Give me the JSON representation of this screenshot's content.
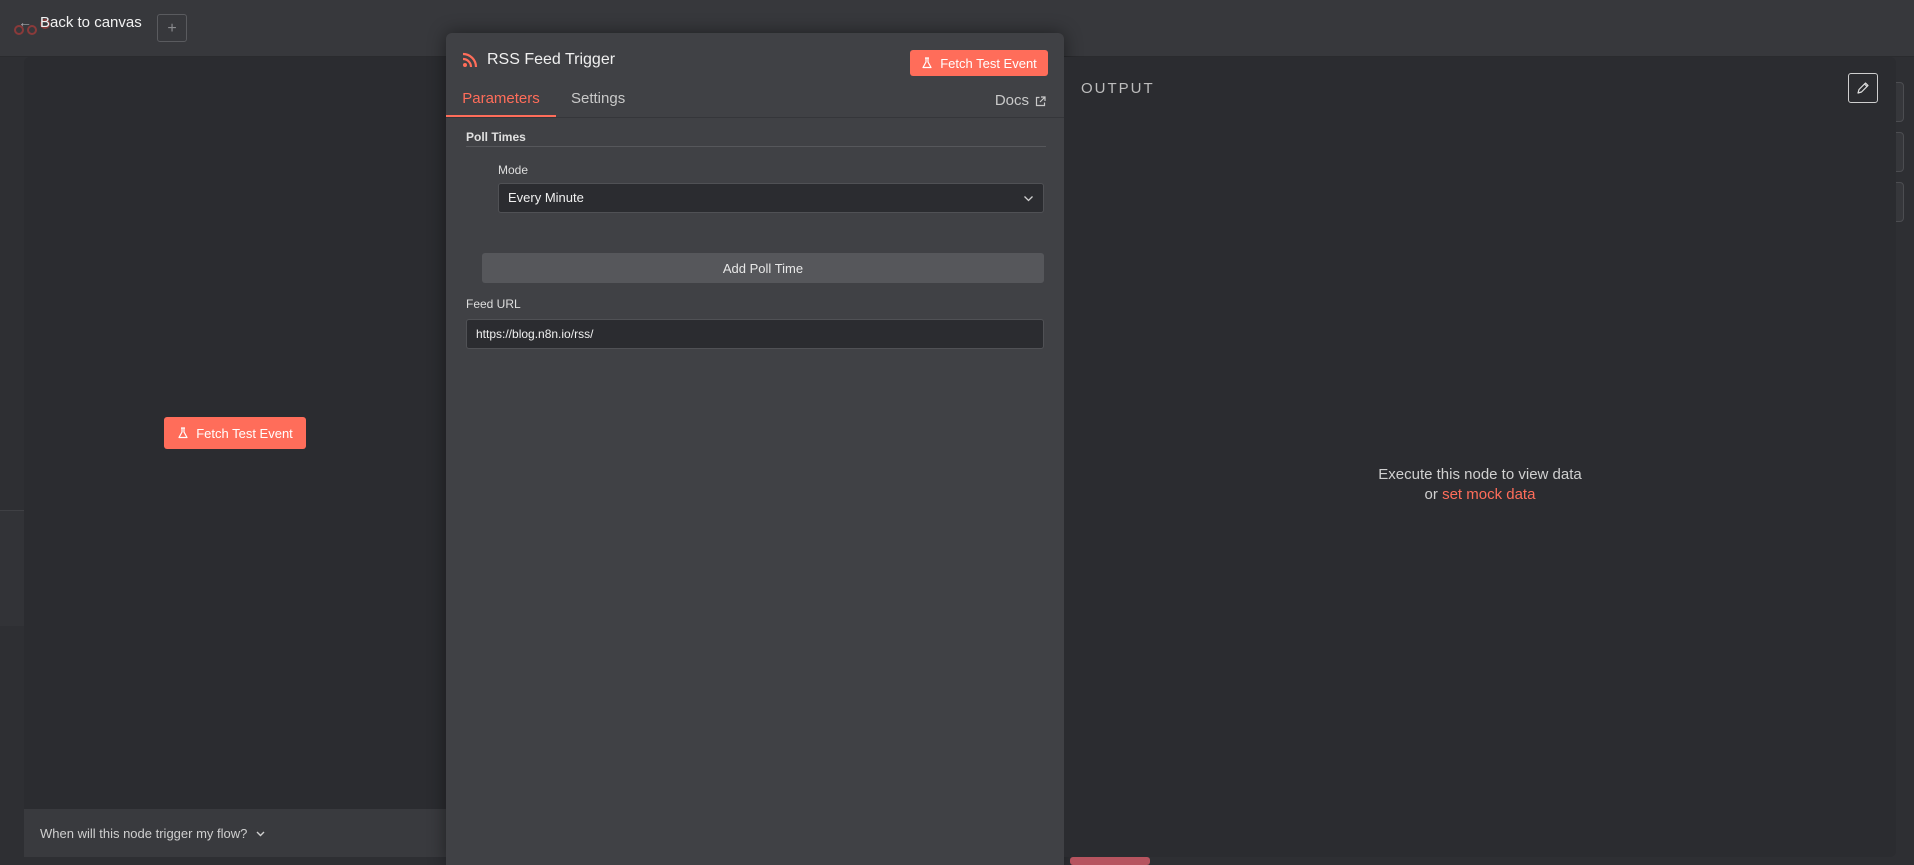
{
  "nav": {
    "back_label": "Back to canvas"
  },
  "colors": {
    "accent": "#ff6d5a",
    "panel_bg": "#404145",
    "side_bg": "#2b2c30"
  },
  "input_panel": {
    "fetch_label": "Fetch Test Event",
    "trigger_question": "When will this node trigger my flow?"
  },
  "node": {
    "icon": "rss-icon",
    "title": "RSS Feed Trigger",
    "fetch_label": "Fetch Test Event",
    "tabs": {
      "parameters": "Parameters",
      "settings": "Settings",
      "docs": "Docs"
    },
    "poll_times": {
      "section_label": "Poll Times",
      "mode_label": "Mode",
      "mode_value": "Every Minute",
      "add_label": "Add Poll Time"
    },
    "feed_url": {
      "label": "Feed URL",
      "value": "https://blog.n8n.io/rss/"
    }
  },
  "output": {
    "title": "OUTPUT",
    "empty_line1": "Execute this node to view data",
    "empty_or": "or",
    "mock_link": "set mock data"
  }
}
